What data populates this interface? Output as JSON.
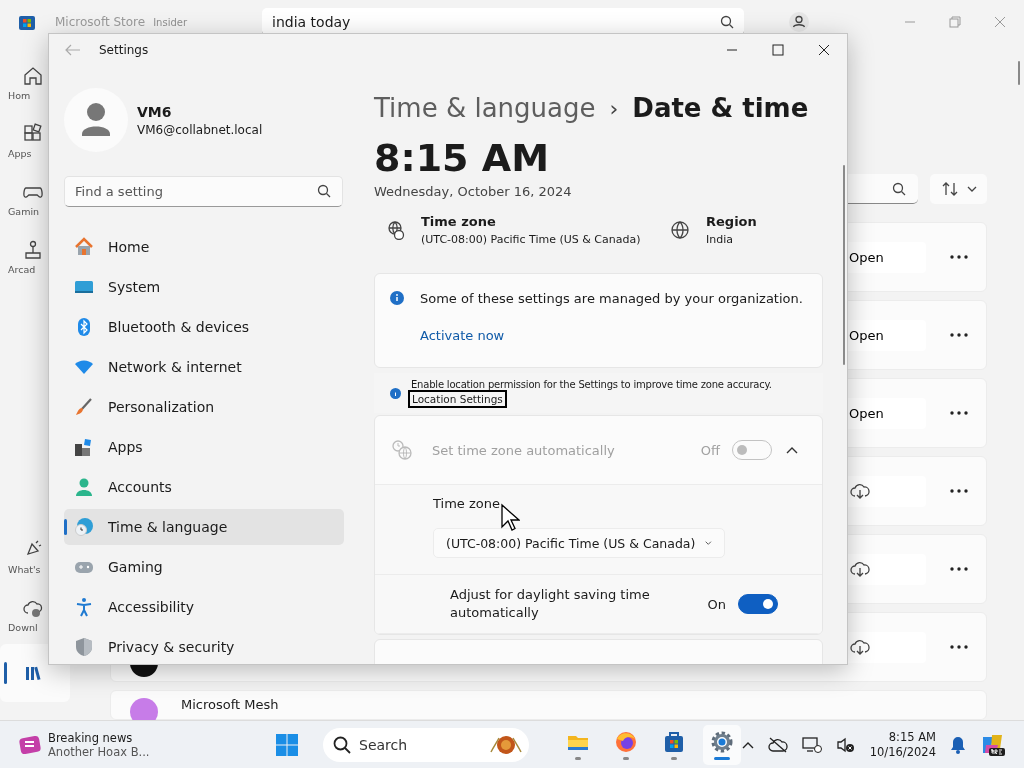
{
  "store": {
    "title": "Microsoft Store",
    "badge": "Insider",
    "search_value": "india today",
    "nav": [
      {
        "label": "Hom",
        "selected": false
      },
      {
        "label": "Apps",
        "selected": false
      },
      {
        "label": "Gamin",
        "selected": false
      },
      {
        "label": "Arcad",
        "selected": false
      },
      {
        "label": "What's",
        "selected": false
      },
      {
        "label": "Downl",
        "selected": false
      },
      {
        "selected": true
      }
    ],
    "apps": [
      {
        "kind": "open",
        "action": "Open"
      },
      {
        "kind": "open",
        "action": "Open"
      },
      {
        "kind": "open",
        "action": "Open"
      },
      {
        "kind": "download"
      },
      {
        "kind": "download"
      },
      {
        "kind": "download"
      },
      {
        "kind": "named",
        "name": "Microsoft Mesh"
      }
    ]
  },
  "settings": {
    "title": "Settings",
    "user": {
      "name": "VM6",
      "email": "VM6@collabnet.local"
    },
    "search": {
      "placeholder": "Find a setting"
    },
    "nav": [
      {
        "label": "Home",
        "selected": false
      },
      {
        "label": "System",
        "selected": false
      },
      {
        "label": "Bluetooth & devices",
        "selected": false
      },
      {
        "label": "Network & internet",
        "selected": false
      },
      {
        "label": "Personalization",
        "selected": false
      },
      {
        "label": "Apps",
        "selected": false
      },
      {
        "label": "Accounts",
        "selected": false
      },
      {
        "label": "Time & language",
        "selected": true
      },
      {
        "label": "Gaming",
        "selected": false
      },
      {
        "label": "Accessibility",
        "selected": false
      },
      {
        "label": "Privacy & security",
        "selected": false
      }
    ],
    "breadcrumb": {
      "parent": "Time & language",
      "separator": "›",
      "current": "Date & time"
    },
    "time": "8:15 AM",
    "date": "Wednesday, October 16, 2024",
    "summary": [
      {
        "title": "Time zone",
        "value": "(UTC-08:00) Pacific Time (US & Canada)"
      },
      {
        "title": "Region",
        "value": "India"
      }
    ],
    "managed": {
      "text": "Some of these settings are managed by your organization.",
      "link": "Activate now"
    },
    "location": {
      "text": "Enable location permission for the Settings to improve time zone accuracy.",
      "link": "Location Settings"
    },
    "auto_timezone": {
      "label": "Set time zone automatically",
      "state_text": "Off",
      "on": false,
      "disabled": true,
      "expanded": true
    },
    "timezone": {
      "label": "Time zone",
      "value": "(UTC-08:00) Pacific Time (US & Canada)"
    },
    "dst": {
      "label": "Adjust for daylight saving time automatically",
      "state_text": "On",
      "on": true,
      "disabled": false
    }
  },
  "taskbar": {
    "news": {
      "title": "Breaking news",
      "subtitle": "Another Hoax B..."
    },
    "search": {
      "placeholder": "Search"
    },
    "apps": [
      {
        "selected": false
      },
      {
        "selected": false
      },
      {
        "selected": false
      },
      {
        "selected": true
      }
    ],
    "time": "8:15 AM",
    "date": "10/16/2024"
  }
}
